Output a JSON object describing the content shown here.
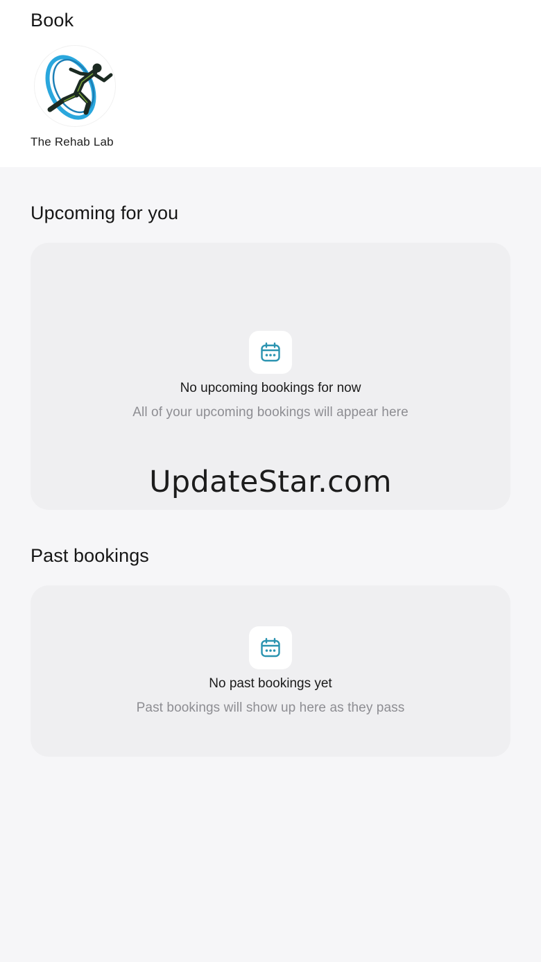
{
  "header": {
    "title": "Book"
  },
  "business": {
    "name": "The Rehab Lab",
    "logo_icon": "running-man-logo-icon"
  },
  "upcoming": {
    "section_title": "Upcoming for you",
    "empty_title": "No upcoming bookings for now",
    "empty_subtitle": "All of your upcoming bookings will appear here",
    "icon": "calendar-icon"
  },
  "past": {
    "section_title": "Past bookings",
    "empty_title": "No past bookings yet",
    "empty_subtitle": "Past bookings will show up here as they pass",
    "icon": "calendar-icon"
  },
  "watermark": {
    "text": "UpdateStar.com"
  },
  "colors": {
    "accent": "#2a93b0",
    "background": "#f6f6f8",
    "card": "#efeff1",
    "muted_text": "#8d8d92"
  }
}
